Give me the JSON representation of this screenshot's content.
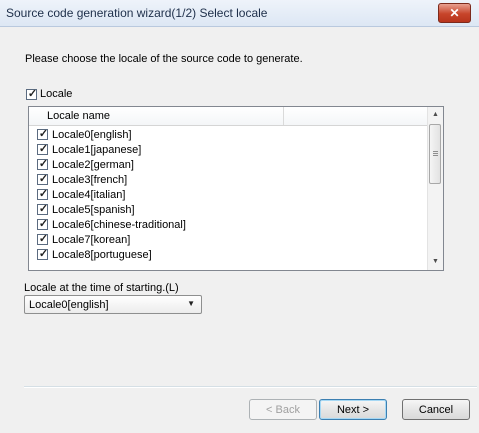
{
  "window": {
    "title": "Source code generation wizard(1/2) Select locale",
    "close_glyph": "✕"
  },
  "instruction": "Please choose the locale of the source code to generate.",
  "locale_toggle": {
    "label": "Locale",
    "checked": true
  },
  "list": {
    "header": "Locale name",
    "items": [
      {
        "label": "Locale0[english]",
        "checked": true
      },
      {
        "label": "Locale1[japanese]",
        "checked": true
      },
      {
        "label": "Locale2[german]",
        "checked": true
      },
      {
        "label": "Locale3[french]",
        "checked": true
      },
      {
        "label": "Locale4[italian]",
        "checked": true
      },
      {
        "label": "Locale5[spanish]",
        "checked": true
      },
      {
        "label": "Locale6[chinese-traditional]",
        "checked": true
      },
      {
        "label": "Locale7[korean]",
        "checked": true
      },
      {
        "label": "Locale8[portuguese]",
        "checked": true
      }
    ]
  },
  "startup": {
    "label": "Locale at the time of starting.(L)",
    "selected": "Locale0[english]"
  },
  "buttons": {
    "back": "< Back",
    "next": "Next >",
    "cancel": "Cancel"
  },
  "colors": {
    "close_button": "#c7442a",
    "dialog_background": "#f0f0f0",
    "default_button_border": "#3c7fb1"
  }
}
